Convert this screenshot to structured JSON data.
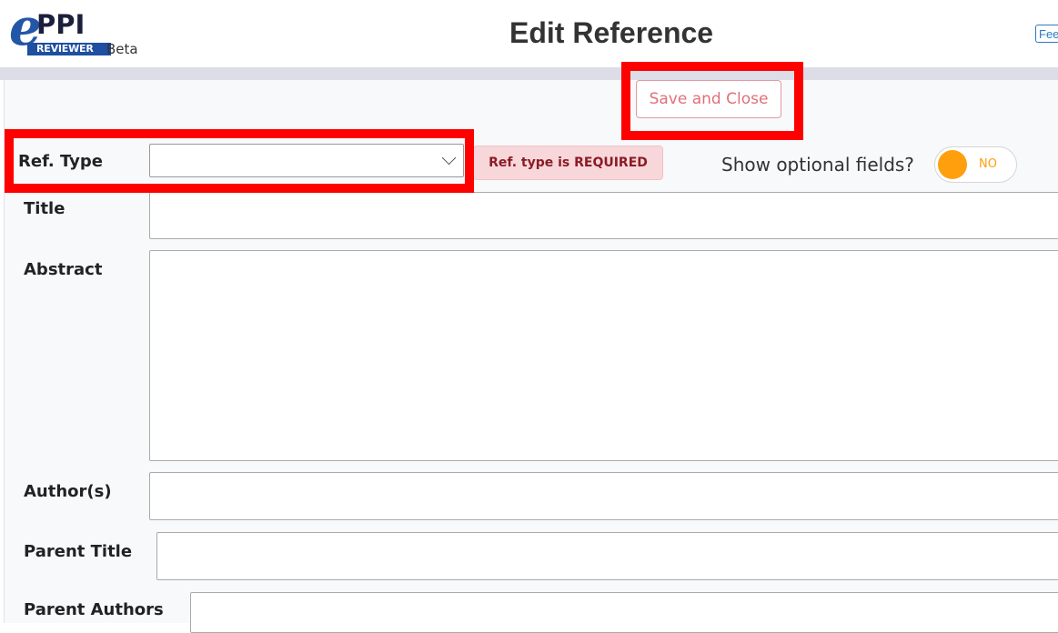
{
  "header": {
    "logo_e": "e",
    "logo_ppi": "PPI",
    "logo_reviewer": "REVIEWER",
    "logo_beta": "Beta",
    "page_title": "Edit Reference",
    "feedback_label": "Feedback"
  },
  "form": {
    "save_close_label": "Save and Close",
    "ref_type": {
      "label": "Ref. Type",
      "value": "",
      "required_message": "Ref. type is REQUIRED"
    },
    "optional_fields": {
      "label": "Show optional fields?",
      "toggle_text": "NO"
    },
    "fields": {
      "title": {
        "label": "Title",
        "value": ""
      },
      "abstract": {
        "label": "Abstract",
        "value": ""
      },
      "authors": {
        "label": "Author(s)",
        "value": ""
      },
      "parent_title": {
        "label": "Parent Title",
        "value": ""
      },
      "parent_authors": {
        "label": "Parent Authors",
        "value": ""
      }
    }
  },
  "colors": {
    "highlight": "#ff0000",
    "accent_orange": "#ff9f0e",
    "danger_text": "#8a1c26",
    "danger_bg": "#f8d7da",
    "logo_blue": "#2356a7"
  }
}
